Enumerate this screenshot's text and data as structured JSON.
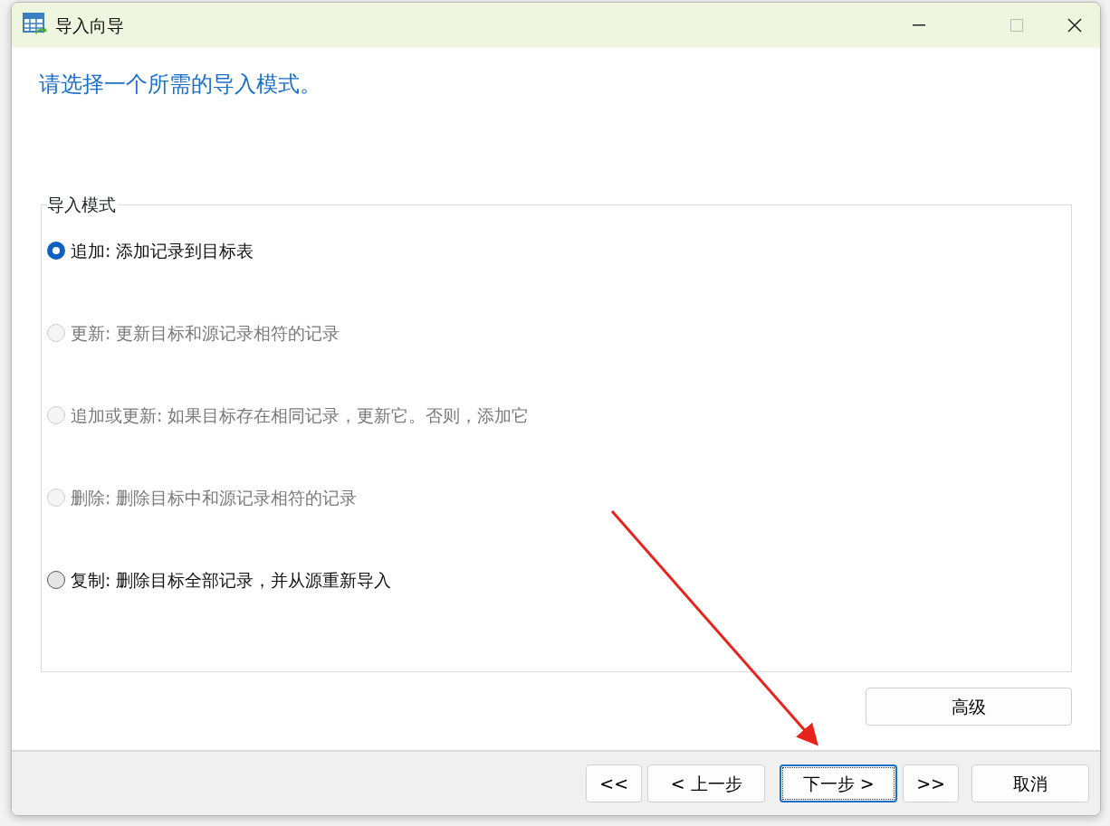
{
  "window": {
    "title": "导入向导"
  },
  "heading": "请选择一个所需的导入模式。",
  "group": {
    "legend": "导入模式",
    "options": [
      {
        "label": "追加: 添加记录到目标表",
        "selected": true,
        "disabled": false
      },
      {
        "label": "更新: 更新目标和源记录相符的记录",
        "selected": false,
        "disabled": true
      },
      {
        "label": "追加或更新: 如果目标存在相同记录，更新它。否则，添加它",
        "selected": false,
        "disabled": true
      },
      {
        "label": "删除: 删除目标中和源记录相符的记录",
        "selected": false,
        "disabled": true
      },
      {
        "label": "复制: 删除目标全部记录，并从源重新导入",
        "selected": false,
        "disabled": false
      }
    ]
  },
  "advanced_button": "高级",
  "footer_buttons": [
    {
      "label": "<<",
      "focused": false
    },
    {
      "label": "< 上一步",
      "focused": false
    },
    {
      "label": "下一步 >",
      "focused": true
    },
    {
      "label": ">>",
      "focused": false
    },
    {
      "label": "取消",
      "focused": false
    }
  ]
}
